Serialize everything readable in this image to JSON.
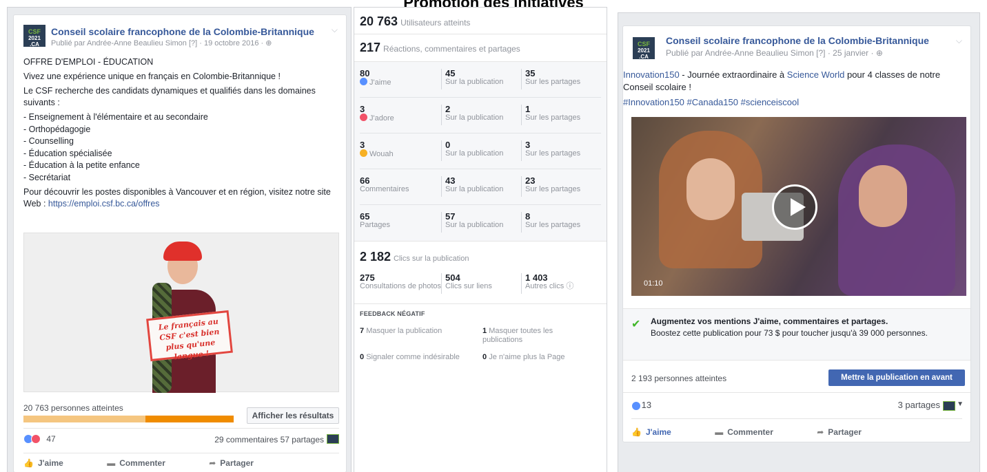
{
  "page_title": "Promotion des initiatives",
  "left_post": {
    "logo_text": "CSF 2021 .CA",
    "page_name": "Conseil scolaire francophone de la Colombie-Britannique",
    "byline": "Publié par Andrée-Anne Beaulieu Simon [?] · 19 octobre 2016 · ",
    "heading": "OFFRE D'EMPLOI - ÉDUCATION",
    "line1": "Vivez une expérience unique en français en Colombie-Britannique !",
    "line2": "Le CSF recherche des candidats dynamiques et qualifiés dans les domaines suivants :",
    "list": [
      "- Enseignement à l'élémentaire et au secondaire",
      "- Orthopédagogie",
      "- Counselling",
      "- Éducation spécialisée",
      "- Éducation à la petite enfance",
      "- Secrétariat"
    ],
    "line3": "Pour découvrir les postes disponibles à Vancouver et en région, visitez notre site Web : ",
    "url": "https://emploi.csf.bc.ca/offres",
    "sign_text": "Le français au CSF c'est bien plus qu'une langue !",
    "reach": "20 763 personnes atteintes",
    "reach_organic_fraction": 0.58,
    "results_button": "Afficher les résultats",
    "reaction_count": "47",
    "comments_shares": "29 commentaires  57 partages",
    "actions": {
      "like": "J'aime",
      "comment": "Commenter",
      "share": "Partager"
    }
  },
  "stats": {
    "users_reached_value": "20 763",
    "users_reached_label": "Utilisateurs atteints",
    "engagement_value": "217",
    "engagement_label": "Réactions, commentaires et partages",
    "rows": [
      {
        "v1": "80",
        "l1": "J'aime",
        "v2": "45",
        "l2": "Sur la publication",
        "v3": "35",
        "l3": "Sur les partages"
      },
      {
        "v1": "3",
        "l1": "J'adore",
        "v2": "2",
        "l2": "Sur la publication",
        "v3": "1",
        "l3": "Sur les partages"
      },
      {
        "v1": "3",
        "l1": "Wouah",
        "v2": "0",
        "l2": "Sur la publication",
        "v3": "3",
        "l3": "Sur les partages"
      },
      {
        "v1": "66",
        "l1": "Commentaires",
        "v2": "43",
        "l2": "Sur la publication",
        "v3": "23",
        "l3": "Sur les partages"
      },
      {
        "v1": "65",
        "l1": "Partages",
        "v2": "57",
        "l2": "Sur la publication",
        "v3": "8",
        "l3": "Sur les partages"
      }
    ],
    "clicks_value": "2 182",
    "clicks_label": "Clics sur la publication",
    "click_breakdown": [
      {
        "v": "275",
        "l": "Consultations de photos"
      },
      {
        "v": "504",
        "l": "Clics sur liens"
      },
      {
        "v": "1 403",
        "l": "Autres clics"
      }
    ],
    "negative_title": "FEEDBACK NÉGATIF",
    "negative": [
      {
        "v": "7",
        "l": "Masquer la publication"
      },
      {
        "v": "1",
        "l": "Masquer toutes les publications"
      },
      {
        "v": "0",
        "l": "Signaler comme indésirable"
      },
      {
        "v": "0",
        "l": "Je n'aime plus la Page"
      }
    ]
  },
  "right_post": {
    "logo_text": "CSF 2021 .CA",
    "page_name": "Conseil scolaire francophone de la Colombie-Britannique",
    "byline": "Publié par Andrée-Anne Beaulieu Simon [?] · 25 janvier · ",
    "tag1": "Innovation150",
    "text_mid": " - Journée extraordinaire à ",
    "tag2": "Science World",
    "text_end": " pour 4 classes de notre Conseil scolaire !",
    "hashtags": "#Innovation150 #Canada150 #scienceiscool",
    "video_time": "01:10",
    "boost_title": "Augmentez vos mentions J'aime, commentaires et partages.",
    "boost_desc": "Boostez cette publication pour 73 $ pour toucher jusqu'à 39 000 personnes.",
    "reached": "2 193 personnes atteintes",
    "boost_button": "Mettre la publication en avant",
    "reaction_count": "13",
    "shares": "3 partages",
    "actions": {
      "like": "J'aime",
      "comment": "Commenter",
      "share": "Partager"
    }
  }
}
